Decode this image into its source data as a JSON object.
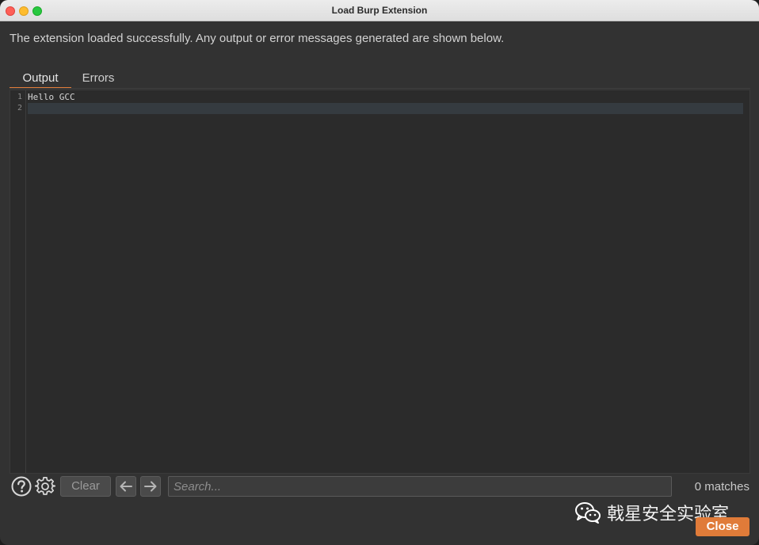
{
  "window": {
    "title": "Load Burp Extension"
  },
  "message": "The extension loaded successfully. Any output or error messages generated are shown below.",
  "tabs": [
    {
      "label": "Output",
      "active": true
    },
    {
      "label": "Errors",
      "active": false
    }
  ],
  "editor": {
    "lines": [
      {
        "number": "1",
        "text": "Hello GCC"
      },
      {
        "number": "2",
        "text": ""
      }
    ]
  },
  "toolbar": {
    "help_icon": "question-circle-icon",
    "settings_icon": "gear-icon",
    "clear_label": "Clear",
    "prev_icon": "arrow-left-icon",
    "next_icon": "arrow-right-icon",
    "search_placeholder": "Search...",
    "matches_text": "0 matches"
  },
  "watermark": {
    "text": "戟星安全实验室",
    "icon": "wechat-icon"
  },
  "footer": {
    "close_label": "Close"
  },
  "colors": {
    "accent": "#e07b39",
    "background": "#323232",
    "editor_background": "#2b2b2b"
  }
}
